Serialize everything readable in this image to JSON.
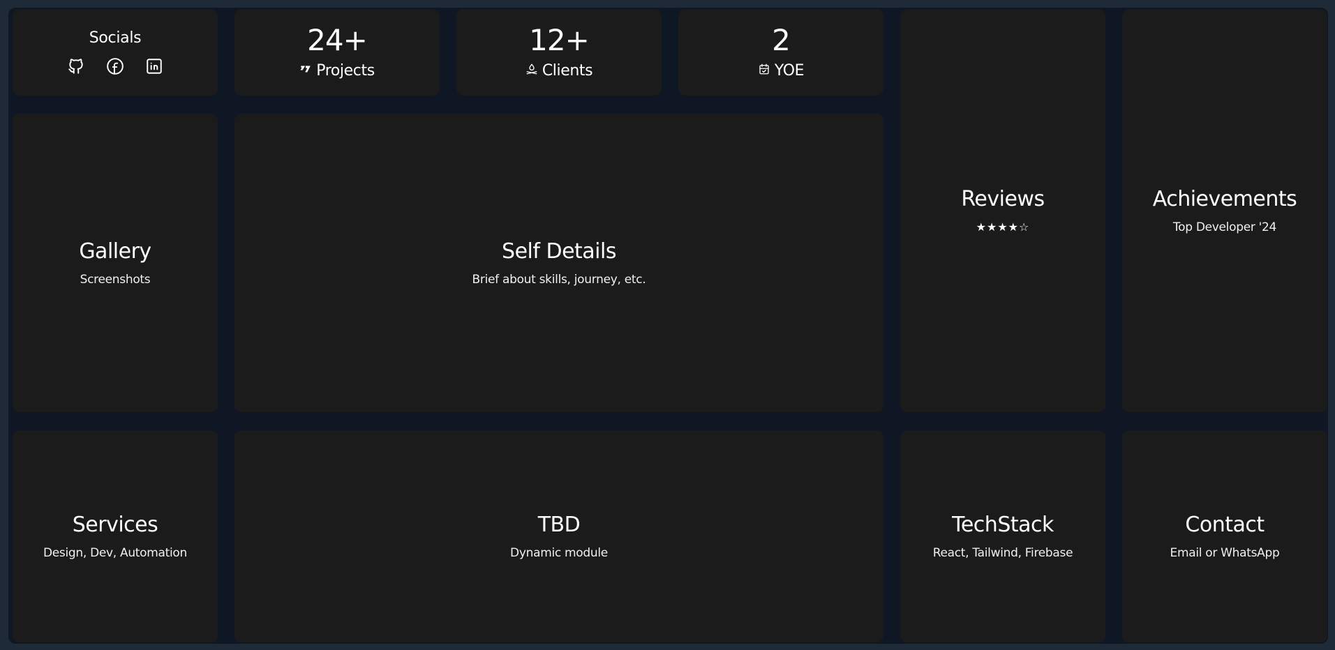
{
  "socials": {
    "title": "Socials",
    "icons": [
      "github-icon",
      "facebook-icon",
      "linkedin-icon"
    ]
  },
  "stats": [
    {
      "value": "24+",
      "label": "Projects",
      "icon": "projects-icon"
    },
    {
      "value": "12+",
      "label": "Clients",
      "icon": "clients-icon"
    },
    {
      "value": "2",
      "label": "YOE",
      "icon": "calendar-check-icon"
    }
  ],
  "gallery": {
    "title": "Gallery",
    "subtitle": "Screenshots"
  },
  "self_details": {
    "title": "Self Details",
    "subtitle": "Brief about skills, journey, etc."
  },
  "reviews": {
    "title": "Reviews",
    "stars": "★★★★☆",
    "rating": 4,
    "max_rating": 5
  },
  "achievements": {
    "title": "Achievements",
    "subtitle": "Top Developer '24"
  },
  "services": {
    "title": "Services",
    "subtitle": "Design, Dev, Automation"
  },
  "tbd": {
    "title": "TBD",
    "subtitle": "Dynamic module"
  },
  "techstack": {
    "title": "TechStack",
    "subtitle": "React, Tailwind, Firebase"
  },
  "contact": {
    "title": "Contact",
    "subtitle": "Email or WhatsApp"
  },
  "colors": {
    "page_background": "#1f2a38",
    "grid_background": "#0f1624",
    "card_background": "#1b1b1b",
    "text": "#ffffff"
  }
}
